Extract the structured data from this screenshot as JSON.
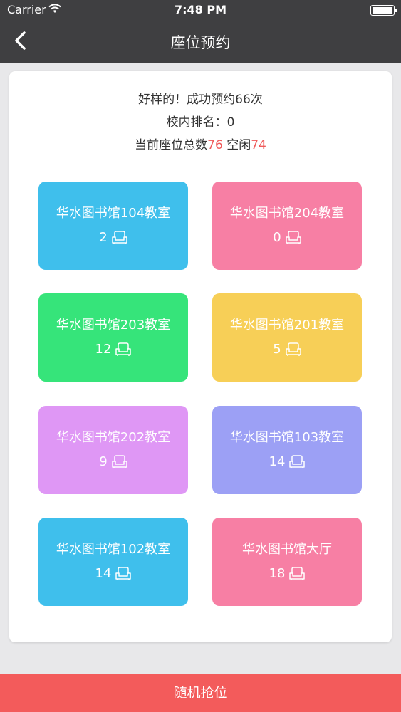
{
  "status_bar": {
    "carrier": "Carrier",
    "time": "7:48 PM"
  },
  "nav": {
    "title": "座位预约"
  },
  "stats": {
    "success_line": "好样的！成功预约66次",
    "rank_line": "校内排名：0",
    "total_label": "当前座位总数",
    "total_value": "76",
    "free_label": "空闲",
    "free_value": "74"
  },
  "rooms": [
    {
      "name": "华水图书馆104教室",
      "count": "2",
      "color": "#3fbfec"
    },
    {
      "name": "华水图书馆204教室",
      "count": "0",
      "color": "#f77fa4"
    },
    {
      "name": "华水图书馆203教室",
      "count": "12",
      "color": "#36e47a"
    },
    {
      "name": "华水图书馆201教室",
      "count": "5",
      "color": "#f7cf57"
    },
    {
      "name": "华水图书馆202教室",
      "count": "9",
      "color": "#df97f5"
    },
    {
      "name": "华水图书馆103教室",
      "count": "14",
      "color": "#9ca0f5"
    },
    {
      "name": "华水图书馆102教室",
      "count": "14",
      "color": "#3fbfec"
    },
    {
      "name": "华水图书馆大厅",
      "count": "18",
      "color": "#f77fa4"
    }
  ],
  "bottom_button": {
    "label": "随机抢位"
  }
}
